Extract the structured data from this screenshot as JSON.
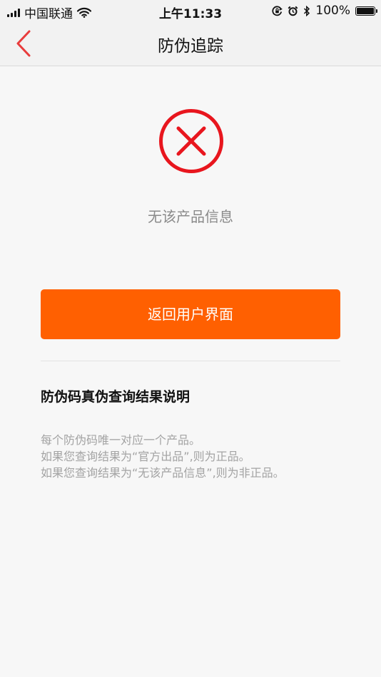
{
  "status_bar": {
    "carrier": "中国联通",
    "time": "上午11:33",
    "battery": "100%"
  },
  "nav": {
    "title": "防伪追踪",
    "back_icon": "chevron-left-icon",
    "accent_color": "#e83c3c"
  },
  "result": {
    "icon": "error-cross-icon",
    "icon_color": "#e8161e",
    "message": "无该产品信息"
  },
  "actions": {
    "return_label": "返回用户界面",
    "button_color": "#ff6001"
  },
  "explanation": {
    "title": "防伪码真伪查询结果说明",
    "lines": [
      "每个防伪码唯一对应一个产品。",
      "如果您查询结果为“官方出品”,则为正品。",
      "如果您查询结果为“无该产品信息”,则为非正品。"
    ]
  }
}
